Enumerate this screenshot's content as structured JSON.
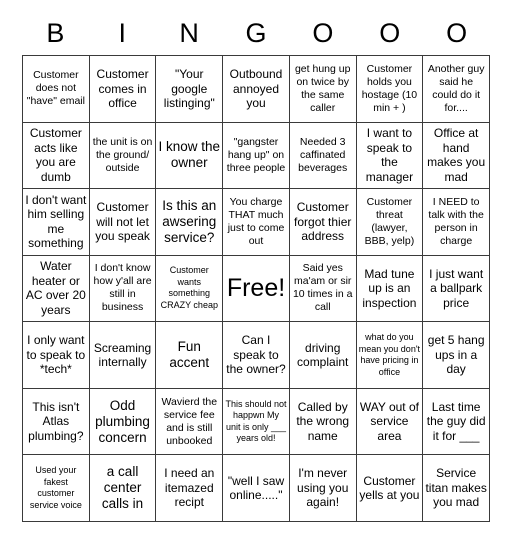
{
  "header": {
    "letters": [
      "B",
      "I",
      "N",
      "G",
      "O",
      "O",
      "O"
    ]
  },
  "grid": {
    "columns": 7,
    "rows": 7,
    "free_space": {
      "row": 3,
      "col": 3,
      "label": "Free!"
    },
    "cells": [
      [
        {
          "text": "Customer does not \"have\" email",
          "size": "s"
        },
        {
          "text": "Customer comes in office",
          "size": "m"
        },
        {
          "text": "\"Your google listinging\"",
          "size": "m"
        },
        {
          "text": "Outbound annoyed you",
          "size": "m"
        },
        {
          "text": "get hung up on twice by the same caller",
          "size": "s"
        },
        {
          "text": "Customer holds you hostage (10 min + )",
          "size": "s"
        },
        {
          "text": "Another guy said he could do it for....",
          "size": "s"
        }
      ],
      [
        {
          "text": "Customer acts like you are dumb",
          "size": "m"
        },
        {
          "text": "the unit is on the ground/ outside",
          "size": "s"
        },
        {
          "text": "I know the owner",
          "size": "l"
        },
        {
          "text": "\"gangster hang up\" on three people",
          "size": "s"
        },
        {
          "text": "Needed 3 caffinated beverages",
          "size": "s"
        },
        {
          "text": "I want to speak to the manager",
          "size": "m"
        },
        {
          "text": "Office at hand makes you mad",
          "size": "m"
        }
      ],
      [
        {
          "text": "I don't want him selling me something",
          "size": "m"
        },
        {
          "text": "Customer will not let you speak",
          "size": "m"
        },
        {
          "text": "Is this an awsering service?",
          "size": "l"
        },
        {
          "text": "You charge THAT much just to come out",
          "size": "s"
        },
        {
          "text": "Customer forgot thier address",
          "size": "m"
        },
        {
          "text": "Customer threat (lawyer, BBB, yelp)",
          "size": "s"
        },
        {
          "text": "I NEED to talk with the person in charge",
          "size": "s"
        }
      ],
      [
        {
          "text": "Water heater or AC over 20 years",
          "size": "m"
        },
        {
          "text": "I don't know how y'all are still in business",
          "size": "s"
        },
        {
          "text": "Customer wants something CRAZY cheap",
          "size": "xs"
        },
        {
          "text": "Free!",
          "size": "free"
        },
        {
          "text": "Said yes ma'am or sir 10 times in a call",
          "size": "s"
        },
        {
          "text": "Mad tune up is an inspection",
          "size": "m"
        },
        {
          "text": "I just want a ballpark price",
          "size": "m"
        }
      ],
      [
        {
          "text": "I only want to speak to *tech*",
          "size": "m"
        },
        {
          "text": "Screaming internally",
          "size": "m"
        },
        {
          "text": "Fun accent",
          "size": "l"
        },
        {
          "text": "Can I speak to the owner?",
          "size": "m"
        },
        {
          "text": "driving complaint",
          "size": "m"
        },
        {
          "text": "what do you mean you don't have pricing in office",
          "size": "xs"
        },
        {
          "text": "get 5 hang ups in a day",
          "size": "m"
        }
      ],
      [
        {
          "text": "This isn't Atlas plumbing?",
          "size": "m"
        },
        {
          "text": "Odd plumbing concern",
          "size": "l"
        },
        {
          "text": "Wavierd the service fee and is still unbooked",
          "size": "s"
        },
        {
          "text": "This should not happwn My unit is only ___ years old!",
          "size": "xs"
        },
        {
          "text": "Called by the wrong name",
          "size": "m"
        },
        {
          "text": "WAY out of service area",
          "size": "m"
        },
        {
          "text": "Last time the guy did it for ___",
          "size": "m"
        }
      ],
      [
        {
          "text": "Used your fakest customer service voice",
          "size": "xs"
        },
        {
          "text": "a call center calls in",
          "size": "l"
        },
        {
          "text": "I need an itemazed recipt",
          "size": "m"
        },
        {
          "text": "\"well I saw online.....\"",
          "size": "m"
        },
        {
          "text": "I'm never using you again!",
          "size": "m"
        },
        {
          "text": "Customer yells at you",
          "size": "m"
        },
        {
          "text": "Service titan makes you mad",
          "size": "m"
        }
      ]
    ]
  }
}
